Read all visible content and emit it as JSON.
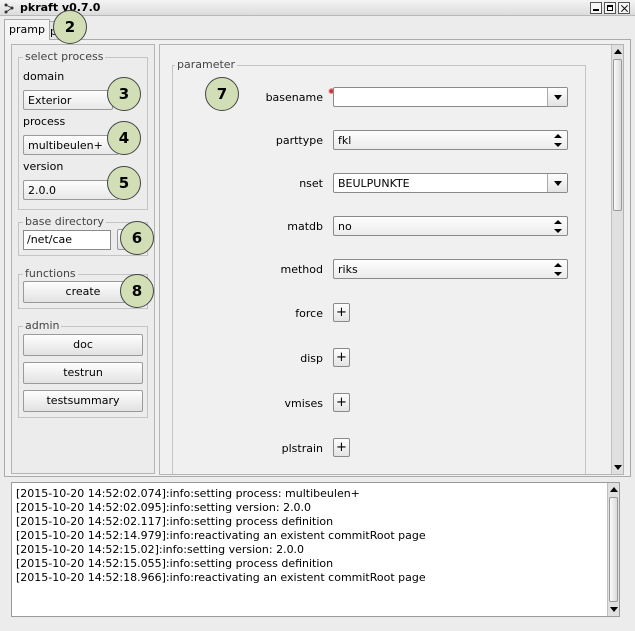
{
  "window": {
    "title": "pkraft v0.7.0"
  },
  "tabs": [
    {
      "label": "pramp"
    },
    {
      "label": "p"
    }
  ],
  "callouts": [
    "2",
    "3",
    "4",
    "5",
    "6",
    "7",
    "8"
  ],
  "select_process": {
    "title": "select process",
    "domain_label": "domain",
    "domain_value": "Exterior",
    "process_label": "process",
    "process_value": "multibeulen+",
    "version_label": "version",
    "version_value": "2.0.0"
  },
  "base_directory": {
    "title": "base directory",
    "path_value": "/net/cae"
  },
  "functions": {
    "title": "functions",
    "create_label": "create"
  },
  "admin": {
    "title": "admin",
    "doc_label": "doc",
    "testrun_label": "testrun",
    "testsummary_label": "testsummary"
  },
  "parameter": {
    "title": "parameter",
    "rows": [
      {
        "label": "basename",
        "value": ""
      },
      {
        "label": "parttype",
        "value": "fkl"
      },
      {
        "label": "nset",
        "value": "BEULPUNKTE"
      },
      {
        "label": "matdb",
        "value": "no"
      },
      {
        "label": "method",
        "value": "riks"
      },
      {
        "label": "force",
        "value": "+"
      },
      {
        "label": "disp",
        "value": "+"
      },
      {
        "label": "vmises",
        "value": "+"
      },
      {
        "label": "plstrain",
        "value": "+"
      }
    ]
  },
  "log": [
    "[2015-10-20 14:52:02.074]:info:setting process: multibeulen+",
    "[2015-10-20 14:52:02.095]:info:setting version: 2.0.0",
    "[2015-10-20 14:52:02.117]:info:setting process definition",
    "[2015-10-20 14:52:14.979]:info:reactivating an existent commitRoot page",
    "[2015-10-20 14:52:15.02]:info:setting version: 2.0.0",
    "[2015-10-20 14:52:15.055]:info:setting process definition",
    "[2015-10-20 14:52:18.966]:info:reactivating an existent commitRoot page"
  ]
}
